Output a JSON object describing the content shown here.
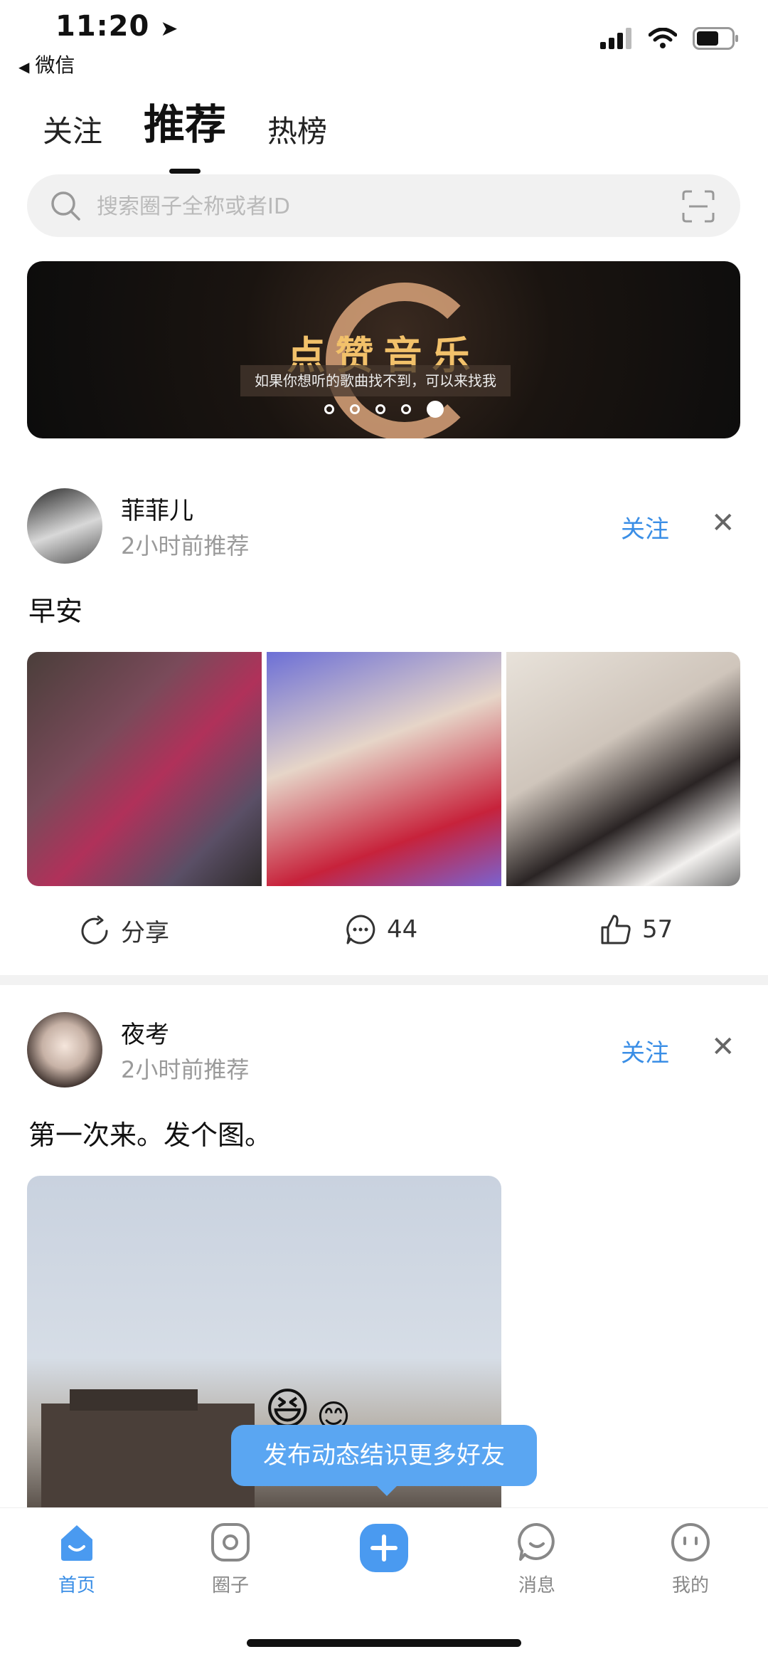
{
  "status_bar": {
    "time": "11:20",
    "back_app": "微信"
  },
  "tabs": [
    {
      "label": "关注",
      "active": false
    },
    {
      "label": "推荐",
      "active": true
    },
    {
      "label": "热榜",
      "active": false
    }
  ],
  "search": {
    "placeholder": "搜索圈子全称或者ID"
  },
  "banner": {
    "title": "点赞音乐",
    "subtitle": "如果你想听的歌曲找不到，可以来找我",
    "dots_total": 5,
    "dots_active_index": 4
  },
  "posts": [
    {
      "username": "菲菲儿",
      "meta": "2小时前推荐",
      "follow_label": "关注",
      "text": "早安",
      "actions": {
        "share": "分享",
        "comments": "44",
        "likes": "57"
      }
    },
    {
      "username": "夜考",
      "meta": "2小时前推荐",
      "follow_label": "关注",
      "text": "第一次来。发个图。"
    }
  ],
  "toast": "发布动态结识更多好友",
  "nav": [
    {
      "label": "首页",
      "icon": "home-icon",
      "active": true
    },
    {
      "label": "圈子",
      "icon": "circle-icon",
      "active": false
    },
    {
      "label": "",
      "icon": "plus-icon",
      "active": false
    },
    {
      "label": "消息",
      "icon": "message-icon",
      "active": false
    },
    {
      "label": "我的",
      "icon": "profile-icon",
      "active": false
    }
  ],
  "colors": {
    "accent": "#3a8ee6",
    "toast": "#5aa6f2",
    "banner_gold": "#f2c16a"
  }
}
